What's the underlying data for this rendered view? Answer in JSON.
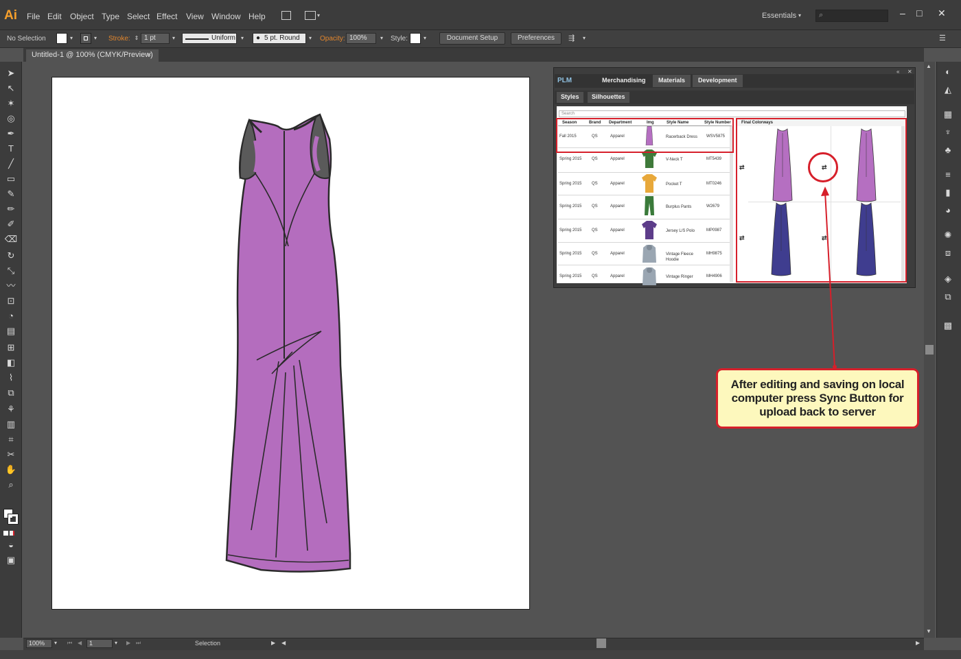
{
  "app": {
    "logo": "Ai",
    "menu": [
      "File",
      "Edit",
      "Object",
      "Type",
      "Select",
      "Effect",
      "View",
      "Window",
      "Help"
    ],
    "workspace": "Essentials",
    "window_controls": [
      "–",
      "□",
      "✕"
    ]
  },
  "control_bar": {
    "selection": "No Selection",
    "stroke_label": "Stroke:",
    "stroke_weight": "1 pt",
    "stroke_profile": "Uniform",
    "brush": "5 pt. Round",
    "opacity_label": "Opacity:",
    "opacity_value": "100%",
    "style_label": "Style:",
    "document_setup": "Document Setup",
    "preferences": "Preferences"
  },
  "document": {
    "tab_title": "Untitled-1 @ 100% (CMYK/Preview)",
    "tab_close": "×"
  },
  "tools": {
    "icons": [
      "selection-tool-icon",
      "direct-selection-icon",
      "magic-wand-icon",
      "lasso-icon",
      "pen-icon",
      "type-icon",
      "line-icon",
      "rectangle-icon",
      "paintbrush-icon",
      "pencil-icon",
      "blob-brush-icon",
      "eraser-icon",
      "rotate-icon",
      "scale-icon",
      "warp-icon",
      "free-transform-icon",
      "shape-builder-icon",
      "perspective-icon",
      "mesh-icon",
      "gradient-icon",
      "eyedropper-icon",
      "blend-icon",
      "symbol-sprayer-icon",
      "graph-icon",
      "artboard-icon",
      "slice-icon",
      "hand-icon",
      "zoom-icon"
    ]
  },
  "plm_panel": {
    "logo": "PLM",
    "tabs": [
      "Merchandising",
      "Materials",
      "Development"
    ],
    "subtabs": [
      "Styles",
      "Silhouettes"
    ],
    "search_placeholder": "Search",
    "columns": [
      "Season",
      "Brand",
      "Department",
      "Img",
      "Style Name",
      "Style Number"
    ],
    "rows": [
      {
        "season": "Fall 2015",
        "brand": "QS",
        "department": "Apparel",
        "style_name": "Racerback Dress",
        "style_number": "WSV5875",
        "img_color": "#b56fc1"
      },
      {
        "season": "Spring 2015",
        "brand": "QS",
        "department": "Apparel",
        "style_name": "V-Neck T",
        "style_number": "MT5439",
        "img_color": "#3f7a3a"
      },
      {
        "season": "Spring 2015",
        "brand": "QS",
        "department": "Apparel",
        "style_name": "Pocket T",
        "style_number": "MT0246",
        "img_color": "#e8a83a"
      },
      {
        "season": "Spring 2015",
        "brand": "QS",
        "department": "Apparel",
        "style_name": "Burplus Pants",
        "style_number": "W2679",
        "img_color": "#3a7a3a"
      },
      {
        "season": "Spring 2015",
        "brand": "QS",
        "department": "Apparel",
        "style_name": "Jersey L/S Polo",
        "style_number": "MP0987",
        "img_color": "#5d3d8a"
      },
      {
        "season": "Spring 2015",
        "brand": "QS",
        "department": "Apparel",
        "style_name": "Vintage Fleece Hoodie",
        "style_number": "MH9875",
        "img_color": "#9aa6b2"
      },
      {
        "season": "Spring 2015",
        "brand": "QS",
        "department": "Apparel",
        "style_name": "Vintage Ringer",
        "style_number": "MH4906",
        "img_color": "#9aa6b2"
      }
    ],
    "colorways_label": "Final Colorways",
    "colorways": [
      {
        "color": "#b56fc1"
      },
      {
        "color": "#b56fc1"
      },
      {
        "color": "#3f3d8f"
      },
      {
        "color": "#3f3d8f"
      }
    ]
  },
  "callout": {
    "text": "After editing and saving on local computer press Sync Button for upload back to server"
  },
  "status_bar": {
    "zoom": "100%",
    "page": "1",
    "tool": "Selection"
  },
  "colors": {
    "dress_fill": "#b46dbe",
    "annotation_red": "#d61f2a",
    "callout_fill": "#fdf8bd"
  }
}
